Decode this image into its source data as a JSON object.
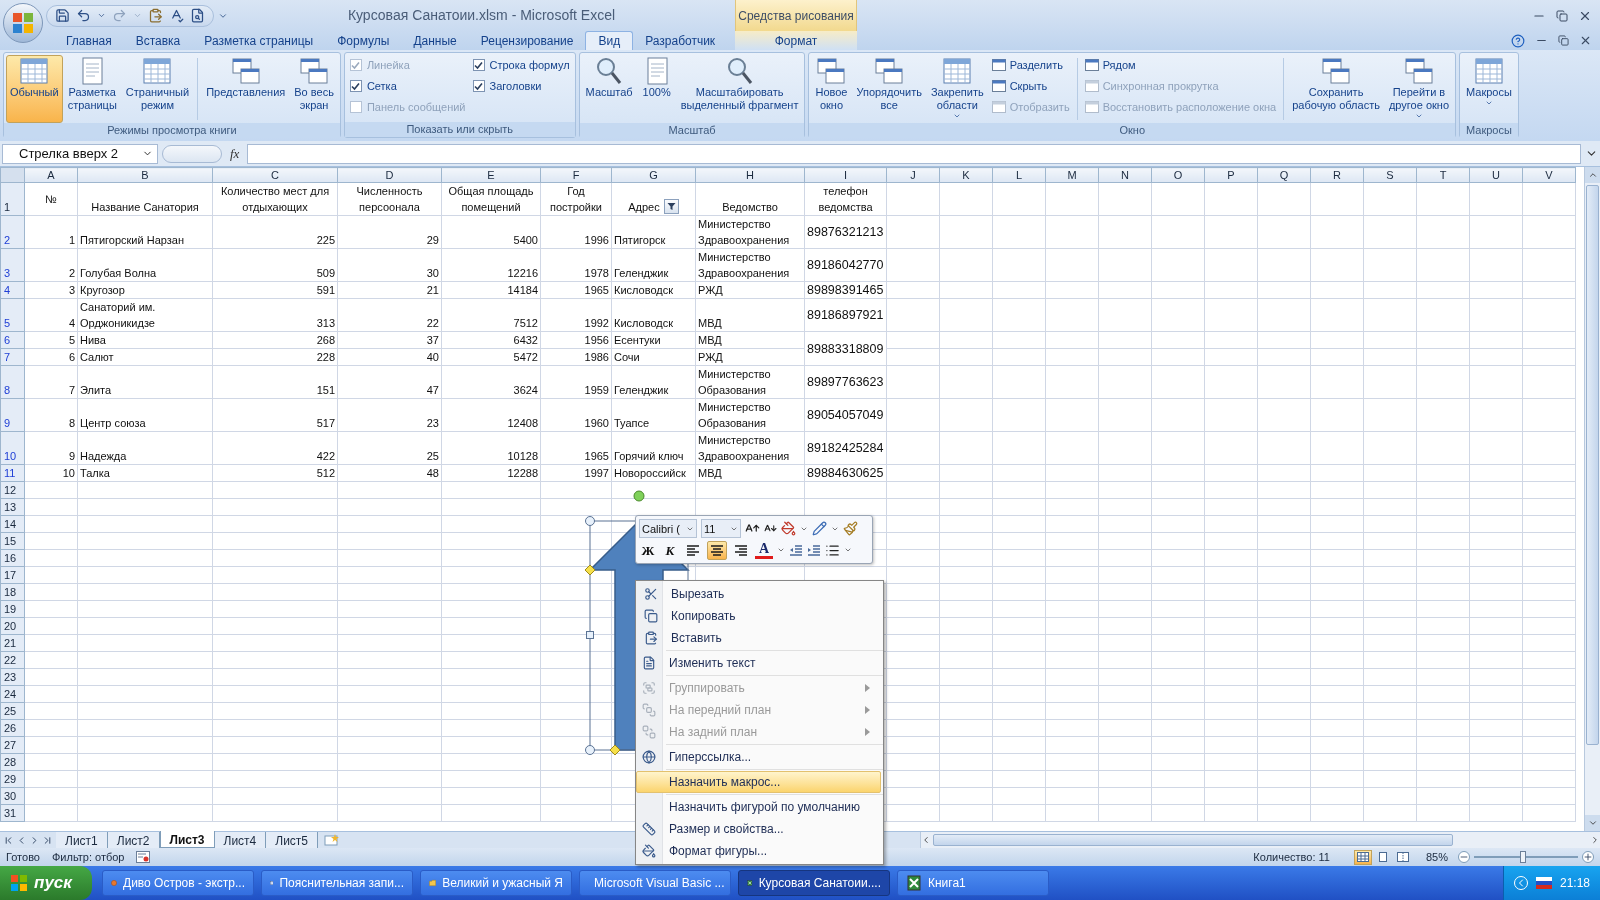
{
  "window": {
    "title": "Курсовая Санатоии.xlsm - Microsoft Excel",
    "contextual_group": "Средства рисования"
  },
  "tabs": [
    {
      "label": "Главная",
      "selected": false
    },
    {
      "label": "Вставка",
      "selected": false
    },
    {
      "label": "Разметка страницы",
      "selected": false
    },
    {
      "label": "Формулы",
      "selected": false
    },
    {
      "label": "Данные",
      "selected": false
    },
    {
      "label": "Рецензирование",
      "selected": false
    },
    {
      "label": "Вид",
      "selected": true
    },
    {
      "label": "Разработчик",
      "selected": false
    }
  ],
  "contextual_tab": {
    "label": "Формат",
    "selected": false
  },
  "ribbon": {
    "groups": [
      {
        "title": "Режимы просмотра книги",
        "controls": [
          {
            "kind": "large",
            "label": "Обычный",
            "selected": true
          },
          {
            "kind": "large",
            "label": "Разметка\nстраницы",
            "selected": false
          },
          {
            "kind": "large",
            "label": "Страничный\nрежим",
            "selected": false
          },
          {
            "kind": "separator"
          },
          {
            "kind": "large",
            "label": "Представления",
            "selected": false
          },
          {
            "kind": "large",
            "label": "Во весь\nэкран",
            "selected": false
          }
        ]
      },
      {
        "title": "Показать или скрыть",
        "controls": [
          {
            "kind": "stack",
            "items": [
              {
                "kind": "check",
                "label": "Линейка",
                "checked": true,
                "disabled": true
              },
              {
                "kind": "check",
                "label": "Сетка",
                "checked": true,
                "disabled": false
              },
              {
                "kind": "check",
                "label": "Панель сообщений",
                "checked": false,
                "disabled": true
              }
            ]
          },
          {
            "kind": "stack",
            "items": [
              {
                "kind": "check",
                "label": "Строка формул",
                "checked": true,
                "disabled": false
              },
              {
                "kind": "check",
                "label": "Заголовки",
                "checked": true,
                "disabled": false
              }
            ]
          }
        ]
      },
      {
        "title": "Масштаб",
        "controls": [
          {
            "kind": "large",
            "label": "Масштаб",
            "selected": false
          },
          {
            "kind": "large",
            "label": "100%",
            "selected": false
          },
          {
            "kind": "large",
            "label": "Масштабировать\nвыделенный фрагмент",
            "selected": false
          }
        ]
      },
      {
        "title": "Окно",
        "controls": [
          {
            "kind": "large",
            "label": "Новое\nокно",
            "selected": false
          },
          {
            "kind": "large",
            "label": "Упорядочить\nвсе",
            "selected": false
          },
          {
            "kind": "large",
            "label": "Закрепить\nобласти",
            "selected": false,
            "dropdown": true
          },
          {
            "kind": "stack",
            "items": [
              {
                "kind": "small",
                "label": "Разделить",
                "disabled": false
              },
              {
                "kind": "small",
                "label": "Скрыть",
                "disabled": false
              },
              {
                "kind": "small",
                "label": "Отобразить",
                "disabled": true
              }
            ]
          },
          {
            "kind": "separator"
          },
          {
            "kind": "stack",
            "items": [
              {
                "kind": "small",
                "label": "Рядом",
                "disabled": false
              },
              {
                "kind": "small",
                "label": "Синхронная прокрутка",
                "disabled": true
              },
              {
                "kind": "small",
                "label": "Восстановить расположение окна",
                "disabled": true
              }
            ]
          },
          {
            "kind": "separator"
          },
          {
            "kind": "large",
            "label": "Сохранить\nрабочую область",
            "selected": false
          },
          {
            "kind": "large",
            "label": "Перейти в\nдругое окно",
            "selected": false,
            "dropdown": true
          }
        ]
      },
      {
        "title": "Макросы",
        "controls": [
          {
            "kind": "large",
            "label": "Макросы",
            "selected": false,
            "dropdown": true
          }
        ]
      }
    ]
  },
  "formula_bar": {
    "name_box": "Стрелка вверх 2",
    "function_button": "fx"
  },
  "sheet": {
    "columns": [
      "A",
      "B",
      "C",
      "D",
      "E",
      "F",
      "G",
      "H",
      "I",
      "J",
      "K",
      "L",
      "M",
      "N",
      "O",
      "P",
      "Q",
      "R",
      "S",
      "T",
      "U",
      "V"
    ],
    "header": {
      "row": "1",
      "filtered": false,
      "cells": [
        {
          "text": "№"
        },
        {
          "text": "Название Санатория"
        },
        {
          "text": "Количество мест для отдыхающих"
        },
        {
          "text": "Численность персоонала"
        },
        {
          "text": "Общая площадь помещений"
        },
        {
          "text": "Год постройки"
        },
        {
          "text": "Адрес",
          "filter": true
        },
        {
          "text": "Ведомство"
        },
        {
          "text": "телефон ведомства"
        }
      ]
    },
    "rows": [
      {
        "row": "2",
        "filtered": true,
        "cells": [
          "1",
          "Пятигорский Нарзан",
          "225",
          "29",
          "5400",
          "1996",
          "Пятигорск",
          "Министерство Здравоохранения"
        ],
        "phone": "89876321213"
      },
      {
        "row": "3",
        "filtered": true,
        "cells": [
          "2",
          "Голубая Волна",
          "509",
          "30",
          "12216",
          "1978",
          "Геленджик",
          "Министерство Здравоохранения"
        ],
        "phone": "89186042770"
      },
      {
        "row": "4",
        "filtered": true,
        "cells": [
          "3",
          "Кругозор",
          "591",
          "21",
          "14184",
          "1965",
          "Кисловодск",
          "РЖД"
        ],
        "phone": "89898391465"
      },
      {
        "row": "5",
        "filtered": true,
        "cells": [
          "4",
          "Санаторий им. Орджоникидзе",
          "313",
          "22",
          "7512",
          "1992",
          "Кисловодск",
          "МВД"
        ],
        "phone": "89186897921"
      },
      {
        "row": "6",
        "filtered": true,
        "cells": [
          "5",
          "Нива",
          "268",
          "37",
          "6432",
          "1956",
          "Есентуки",
          "МВД"
        ],
        "phone": "89883318809",
        "phone_merged_down": true
      },
      {
        "row": "7",
        "filtered": true,
        "cells": [
          "6",
          "Салют",
          "228",
          "40",
          "5472",
          "1986",
          "Сочи",
          "РЖД"
        ]
      },
      {
        "row": "8",
        "filtered": true,
        "cells": [
          "7",
          "Элита",
          "151",
          "47",
          "3624",
          "1959",
          "Геленджик",
          "Министерство Образования"
        ],
        "phone": "89897763623"
      },
      {
        "row": "9",
        "filtered": true,
        "cells": [
          "8",
          "Центр союза",
          "517",
          "23",
          "12408",
          "1960",
          "Туапсе",
          "Министерство Образования"
        ],
        "phone": "89054057049"
      },
      {
        "row": "10",
        "filtered": true,
        "cells": [
          "9",
          "Надежда",
          "422",
          "25",
          "10128",
          "1965",
          "Горячий ключ",
          "Министерство Здравоохранения"
        ],
        "phone": "89182425284"
      },
      {
        "row": "11",
        "filtered": true,
        "cells": [
          "10",
          "Талка",
          "512",
          "48",
          "12288",
          "1997",
          "Новороссийск",
          "МВД"
        ],
        "phone": "89884630625"
      }
    ],
    "empty_rows": [
      "12",
      "13",
      "14",
      "15",
      "16",
      "17",
      "18",
      "19",
      "20",
      "21",
      "22",
      "23",
      "24",
      "25",
      "26",
      "27",
      "28",
      "29",
      "30",
      "31"
    ]
  },
  "mini_toolbar": {
    "font": "Calibri (",
    "size": "11",
    "bold": "Ж",
    "italic": "К",
    "font_color": "A",
    "align": [
      {
        "kind": "left",
        "selected": false
      },
      {
        "kind": "center",
        "selected": true
      },
      {
        "kind": "right",
        "selected": false
      }
    ]
  },
  "context_menu": {
    "groups": [
      [
        {
          "label": "Вырезать",
          "disabled": false,
          "selected": false
        },
        {
          "label": "Копировать",
          "disabled": false,
          "selected": false
        },
        {
          "label": "Вставить",
          "disabled": false,
          "selected": false
        }
      ],
      [
        {
          "label": "Изменить текст",
          "disabled": false,
          "selected": false
        }
      ],
      [
        {
          "label": "Группировать",
          "disabled": true,
          "selected": false,
          "submenu": true
        },
        {
          "label": "На передний план",
          "disabled": true,
          "selected": false,
          "submenu": true
        },
        {
          "label": "На задний план",
          "disabled": true,
          "selected": false,
          "submenu": true
        }
      ],
      [
        {
          "label": "Гиперссылка...",
          "disabled": false,
          "selected": false
        }
      ],
      [
        {
          "label": "Назначить макрос...",
          "disabled": false,
          "selected": true
        }
      ],
      [
        {
          "label": "Назначить фигурой по умолчанию",
          "disabled": false,
          "selected": false
        },
        {
          "label": "Размер и свойства...",
          "disabled": false,
          "selected": false
        },
        {
          "label": "Формат фигуры...",
          "disabled": false,
          "selected": false
        }
      ]
    ]
  },
  "sheet_tabs": [
    {
      "label": "Лист1",
      "selected": false
    },
    {
      "label": "Лист2",
      "selected": false
    },
    {
      "label": "Лист3",
      "selected": true
    },
    {
      "label": "Лист4",
      "selected": false
    },
    {
      "label": "Лист5",
      "selected": false
    }
  ],
  "status_bar": {
    "items": [
      "Готово",
      "Фильтр: отбор"
    ],
    "count": "Количество: 11",
    "views": [
      {
        "kind": "normal",
        "selected": true
      },
      {
        "kind": "page_layout",
        "selected": false
      },
      {
        "kind": "page_break",
        "selected": false
      }
    ],
    "zoom": "85%",
    "zoom_slider": {
      "level": 0.47
    }
  },
  "taskbar": {
    "start": "пуск",
    "tasks": [
      {
        "label": "Диво Остров - экстр...",
        "selected": false
      },
      {
        "label": "Пояснительная запи...",
        "selected": false
      },
      {
        "label": "Великий и ужасный Я",
        "selected": false
      },
      {
        "label": "Microsoft Visual Basic ...",
        "selected": false
      },
      {
        "label": "Курсовая Санатоии....",
        "selected": true
      },
      {
        "label": "Книга1",
        "selected": false
      }
    ],
    "clock": "21:18"
  }
}
